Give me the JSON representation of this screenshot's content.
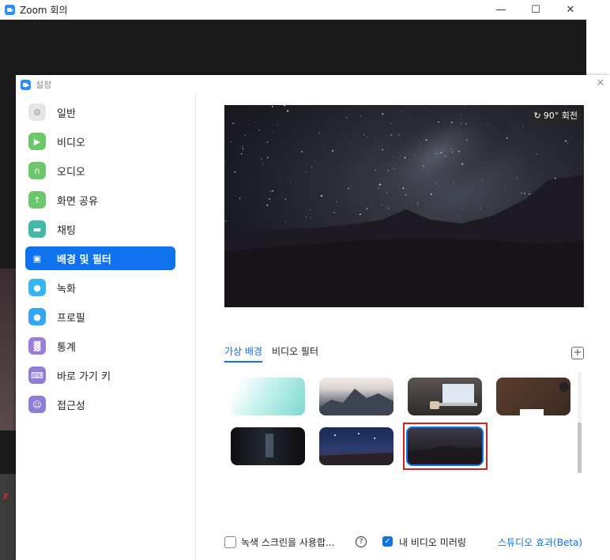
{
  "zoom_window": {
    "title": "Zoom 회의",
    "minimize_icon": "minimize-icon",
    "maximize_icon": "maximize-icon",
    "close_icon": "close-icon"
  },
  "settings": {
    "title": "설정",
    "close_icon": "close-icon",
    "sidebar": {
      "items": [
        {
          "label": "일반",
          "icon": "gear-icon",
          "color": "#e6e6e6"
        },
        {
          "label": "비디오",
          "icon": "video-camera-icon",
          "color": "#6cc76c"
        },
        {
          "label": "오디오",
          "icon": "headphones-icon",
          "color": "#6cc76c"
        },
        {
          "label": "화면 공유",
          "icon": "share-screen-icon",
          "color": "#6cc76c"
        },
        {
          "label": "채팅",
          "icon": "chat-icon",
          "color": "#41b8a8"
        },
        {
          "label": "배경 및 필터",
          "icon": "background-icon",
          "color": "#0e72ed"
        },
        {
          "label": "녹화",
          "icon": "record-icon",
          "color": "#35b5f5"
        },
        {
          "label": "프로필",
          "icon": "profile-icon",
          "color": "#35a6f5"
        },
        {
          "label": "통계",
          "icon": "statistics-icon",
          "color": "#9b7de0"
        },
        {
          "label": "바로 가기 키",
          "icon": "keyboard-icon",
          "color": "#8f7dd6"
        },
        {
          "label": "접근성",
          "icon": "accessibility-icon",
          "color": "#8f7dd6"
        }
      ],
      "active_index": 5
    },
    "preview": {
      "rotate_label": "90° 회전",
      "rotate_icon": "rotate-icon"
    },
    "tabs": [
      {
        "label": "가상 배경",
        "active": true
      },
      {
        "label": "비디오 필터",
        "active": false
      }
    ],
    "add_background_icon": "plus-icon",
    "backgrounds": [
      {
        "name": "aqua-gradient",
        "selected": false
      },
      {
        "name": "mountains",
        "selected": false
      },
      {
        "name": "desk-laptop",
        "selected": false
      },
      {
        "name": "wooden-desk",
        "selected": false
      },
      {
        "name": "dark-room",
        "selected": false
      },
      {
        "name": "night-sky-city",
        "selected": false
      },
      {
        "name": "milky-way",
        "selected": true
      }
    ],
    "bottom": {
      "green_screen_label": "녹색 스크린을 사용합...",
      "green_screen_checked": false,
      "help_icon": "help-icon",
      "mirror_label": "내 비디오 미러링",
      "mirror_checked": true,
      "studio_label": "스튜디오 효과(Beta)"
    },
    "accent_color": "#0e72ed",
    "selection_highlight_color": "#e01d1d"
  }
}
